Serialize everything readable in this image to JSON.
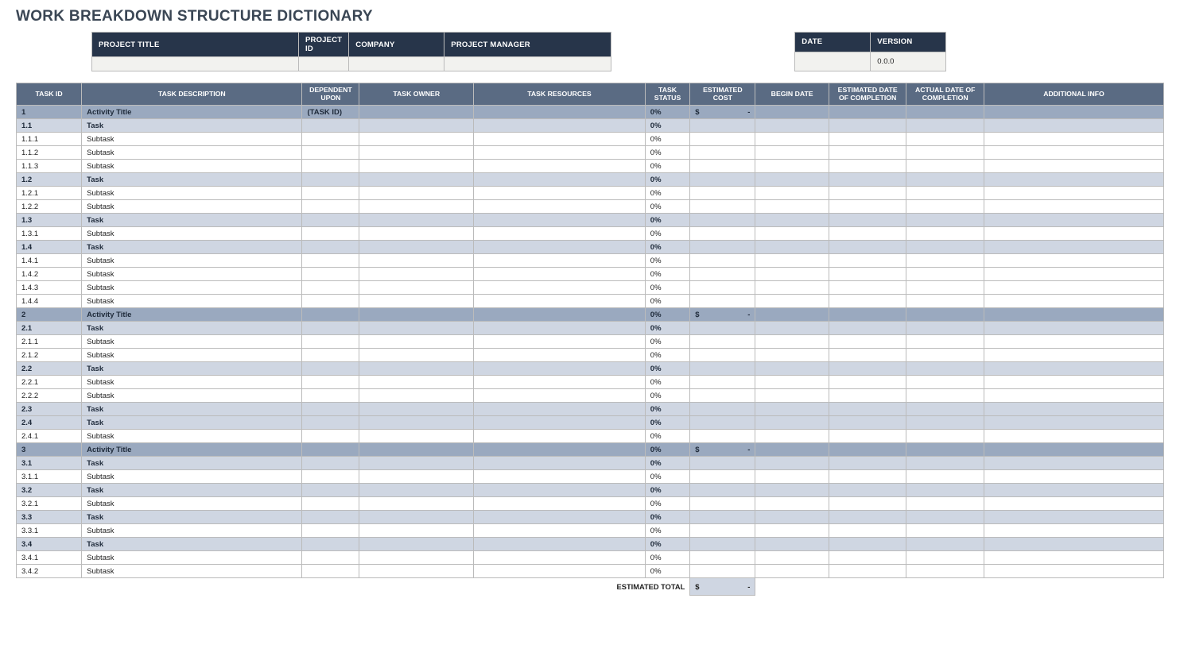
{
  "title": "WORK BREAKDOWN STRUCTURE DICTIONARY",
  "meta_left": {
    "headers": {
      "project_title": "PROJECT TITLE",
      "project_id": "PROJECT ID",
      "company": "COMPANY",
      "project_manager": "PROJECT MANAGER"
    },
    "values": {
      "project_title": "",
      "project_id": "",
      "company": "",
      "project_manager": ""
    }
  },
  "meta_right": {
    "headers": {
      "date": "DATE",
      "version": "VERSION"
    },
    "values": {
      "date": "",
      "version": "0.0.0"
    }
  },
  "columns": {
    "task_id": "TASK ID",
    "task_description": "TASK DESCRIPTION",
    "dependent_upon": "DEPENDENT UPON",
    "task_owner": "TASK OWNER",
    "task_resources": "TASK RESOURCES",
    "task_status": "TASK STATUS",
    "estimated_cost": "ESTIMATED COST",
    "begin_date": "BEGIN DATE",
    "est_date": "ESTIMATED DATE OF COMPLETION",
    "act_date": "ACTUAL DATE OF COMPLETION",
    "additional_info": "ADDITIONAL INFO"
  },
  "rows": [
    {
      "level": "activity",
      "id": "1",
      "desc": "Activity Title",
      "dep": "(TASK ID)",
      "status": "0%",
      "cost_sym": "$",
      "cost_val": "-"
    },
    {
      "level": "task",
      "id": "1.1",
      "desc": "Task",
      "status": "0%"
    },
    {
      "level": "subtask",
      "id": "1.1.1",
      "desc": "Subtask",
      "status": "0%"
    },
    {
      "level": "subtask",
      "id": "1.1.2",
      "desc": "Subtask",
      "status": "0%"
    },
    {
      "level": "subtask",
      "id": "1.1.3",
      "desc": "Subtask",
      "status": "0%"
    },
    {
      "level": "task",
      "id": "1.2",
      "desc": "Task",
      "status": "0%"
    },
    {
      "level": "subtask",
      "id": "1.2.1",
      "desc": "Subtask",
      "status": "0%"
    },
    {
      "level": "subtask",
      "id": "1.2.2",
      "desc": "Subtask",
      "status": "0%"
    },
    {
      "level": "task",
      "id": "1.3",
      "desc": "Task",
      "status": "0%"
    },
    {
      "level": "subtask",
      "id": "1.3.1",
      "desc": "Subtask",
      "status": "0%"
    },
    {
      "level": "task",
      "id": "1.4",
      "desc": "Task",
      "status": "0%"
    },
    {
      "level": "subtask",
      "id": "1.4.1",
      "desc": "Subtask",
      "status": "0%"
    },
    {
      "level": "subtask",
      "id": "1.4.2",
      "desc": "Subtask",
      "status": "0%"
    },
    {
      "level": "subtask",
      "id": "1.4.3",
      "desc": "Subtask",
      "status": "0%"
    },
    {
      "level": "subtask",
      "id": "1.4.4",
      "desc": "Subtask",
      "status": "0%"
    },
    {
      "level": "activity",
      "id": "2",
      "desc": "Activity Title",
      "status": "0%",
      "cost_sym": "$",
      "cost_val": "-"
    },
    {
      "level": "task",
      "id": "2.1",
      "desc": "Task",
      "status": "0%"
    },
    {
      "level": "subtask",
      "id": "2.1.1",
      "desc": "Subtask",
      "status": "0%"
    },
    {
      "level": "subtask",
      "id": "2.1.2",
      "desc": "Subtask",
      "status": "0%"
    },
    {
      "level": "task",
      "id": "2.2",
      "desc": "Task",
      "status": "0%"
    },
    {
      "level": "subtask",
      "id": "2.2.1",
      "desc": "Subtask",
      "status": "0%"
    },
    {
      "level": "subtask",
      "id": "2.2.2",
      "desc": "Subtask",
      "status": "0%"
    },
    {
      "level": "task",
      "id": "2.3",
      "desc": "Task",
      "status": "0%"
    },
    {
      "level": "task",
      "id": "2.4",
      "desc": "Task",
      "status": "0%"
    },
    {
      "level": "subtask",
      "id": "2.4.1",
      "desc": "Subtask",
      "status": "0%"
    },
    {
      "level": "activity",
      "id": "3",
      "desc": "Activity Title",
      "status": "0%",
      "cost_sym": "$",
      "cost_val": "-"
    },
    {
      "level": "task",
      "id": "3.1",
      "desc": "Task",
      "status": "0%"
    },
    {
      "level": "subtask",
      "id": "3.1.1",
      "desc": "Subtask",
      "status": "0%"
    },
    {
      "level": "task",
      "id": "3.2",
      "desc": "Task",
      "status": "0%"
    },
    {
      "level": "subtask",
      "id": "3.2.1",
      "desc": "Subtask",
      "status": "0%"
    },
    {
      "level": "task",
      "id": "3.3",
      "desc": "Task",
      "status": "0%"
    },
    {
      "level": "subtask",
      "id": "3.3.1",
      "desc": "Subtask",
      "status": "0%"
    },
    {
      "level": "task",
      "id": "3.4",
      "desc": "Task",
      "status": "0%"
    },
    {
      "level": "subtask",
      "id": "3.4.1",
      "desc": "Subtask",
      "status": "0%"
    },
    {
      "level": "subtask",
      "id": "3.4.2",
      "desc": "Subtask",
      "status": "0%"
    }
  ],
  "total": {
    "label": "ESTIMATED TOTAL",
    "sym": "$",
    "val": "-"
  }
}
